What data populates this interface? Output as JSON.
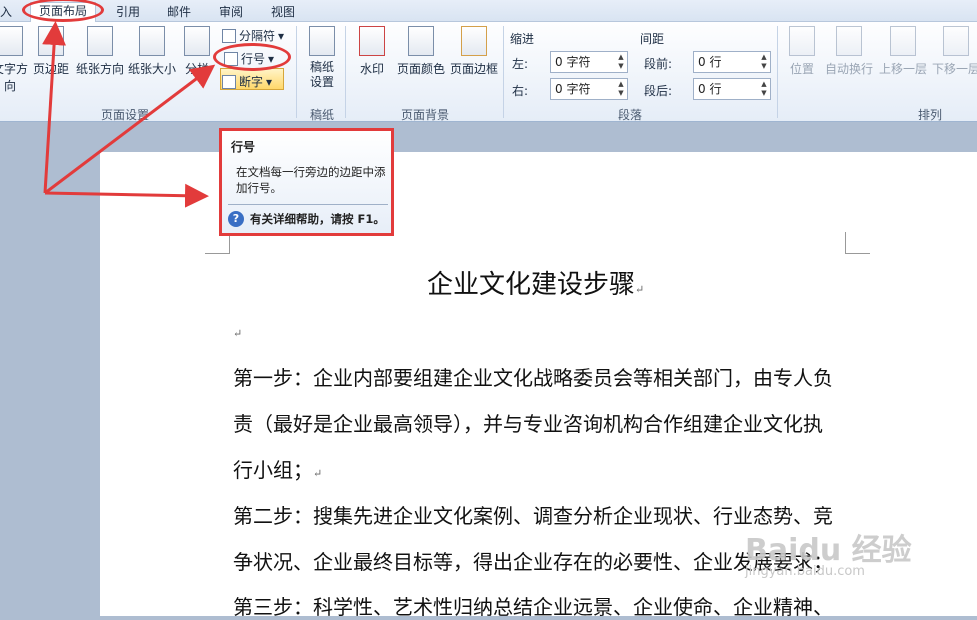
{
  "tabs": [
    "入",
    "页面布局",
    "引用",
    "邮件",
    "审阅",
    "视图"
  ],
  "ribbon": {
    "page_setup": {
      "buttons": [
        "文字方向",
        "页边距",
        "纸张方向",
        "纸张大小",
        "分栏"
      ],
      "small": [
        "分隔符",
        "行号",
        "断字"
      ],
      "label": "页面设置"
    },
    "manuscript": {
      "button": "稿纸设置",
      "label": "稿纸"
    },
    "page_bg": {
      "buttons": [
        "水印",
        "页面颜色",
        "页面边框"
      ],
      "label": "页面背景"
    },
    "paragraph": {
      "indent_title": "缩进",
      "left_label": "左:",
      "left_value": "0 字符",
      "right_label": "右:",
      "right_value": "0 字符",
      "spacing_title": "间距",
      "before_label": "段前:",
      "before_value": "0 行",
      "after_label": "段后:",
      "after_value": "0 行",
      "label": "段落"
    },
    "arrange": {
      "buttons": [
        "位置",
        "自动换行",
        "上移一层",
        "下移一层"
      ],
      "label": "排列"
    }
  },
  "tooltip": {
    "title": "行号",
    "body": "在文档每一行旁边的边距中添加行号。",
    "help": "有关详细帮助，请按 F1。"
  },
  "document": {
    "title": "企业文化建设步骤",
    "lines": [
      "第一步：企业内部要组建企业文化战略委员会等相关部门，由专人负",
      "责（最好是企业最高领导），并与专业咨询机构合作组建企业文化执",
      "行小组；",
      "第二步：搜集先进企业文化案例、调查分析企业现状、行业态势、竞",
      "争状况、企业最终目标等，得出企业存在的必要性、企业发展要求；",
      "第三步：科学性、艺术性归纳总结企业远景、企业使命、企业精神、"
    ]
  },
  "watermark": {
    "main": "Baidu 经验",
    "sub": "jingyan.baidu.com"
  },
  "colors": {
    "annotation": "#e23b3b",
    "ribbon_bg": "#e5edf7",
    "highlight": "#ffd86b"
  }
}
